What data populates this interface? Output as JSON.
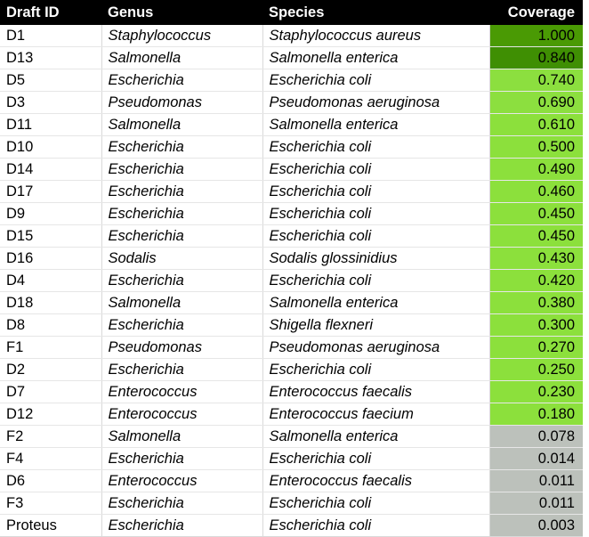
{
  "table": {
    "columns": [
      {
        "key": "draft_id",
        "label": "Draft ID",
        "align": "left"
      },
      {
        "key": "genus",
        "label": "Genus",
        "align": "left"
      },
      {
        "key": "species",
        "label": "Species",
        "align": "left"
      },
      {
        "key": "coverage",
        "label": "Coverage",
        "align": "right"
      }
    ],
    "colors": {
      "header_bg": "#000000",
      "header_text": "#ffffff",
      "row_bg": "#ffffff",
      "row_text": "#000000",
      "grid_line": "#d9d9d9",
      "heat_high": "#4a9a04",
      "heat_mid": "#8cdf3f",
      "heat_low": "#bcc1bb"
    },
    "rows": [
      {
        "draft_id": "D1",
        "genus": "Staphylococcus",
        "species": "Staphylococcus aureus",
        "coverage": "1.000",
        "coverage_value": 1.0,
        "cell_color": "#4a9a04"
      },
      {
        "draft_id": "D13",
        "genus": "Salmonella",
        "species": "Salmonella enterica",
        "coverage": "0.840",
        "coverage_value": 0.84,
        "cell_color": "#3f8f03"
      },
      {
        "draft_id": "D5",
        "genus": "Escherichia",
        "species": "Escherichia coli",
        "coverage": "0.740",
        "coverage_value": 0.74,
        "cell_color": "#8cdf3f"
      },
      {
        "draft_id": "D3",
        "genus": "Pseudomonas",
        "species": "Pseudomonas aeruginosa",
        "coverage": "0.690",
        "coverage_value": 0.69,
        "cell_color": "#8cdf3f"
      },
      {
        "draft_id": "D11",
        "genus": "Salmonella",
        "species": "Salmonella enterica",
        "coverage": "0.610",
        "coverage_value": 0.61,
        "cell_color": "#8ce03c"
      },
      {
        "draft_id": "D10",
        "genus": "Escherichia",
        "species": "Escherichia coli",
        "coverage": "0.500",
        "coverage_value": 0.5,
        "cell_color": "#8ce03c"
      },
      {
        "draft_id": "D14",
        "genus": "Escherichia",
        "species": "Escherichia coli",
        "coverage": "0.490",
        "coverage_value": 0.49,
        "cell_color": "#8ce03c"
      },
      {
        "draft_id": "D17",
        "genus": "Escherichia",
        "species": "Escherichia coli",
        "coverage": "0.460",
        "coverage_value": 0.46,
        "cell_color": "#8ce03c"
      },
      {
        "draft_id": "D9",
        "genus": "Escherichia",
        "species": "Escherichia coli",
        "coverage": "0.450",
        "coverage_value": 0.45,
        "cell_color": "#8ce03c"
      },
      {
        "draft_id": "D15",
        "genus": "Escherichia",
        "species": "Escherichia coli",
        "coverage": "0.450",
        "coverage_value": 0.45,
        "cell_color": "#8ce03c"
      },
      {
        "draft_id": "D16",
        "genus": "Sodalis",
        "species": "Sodalis glossinidius",
        "coverage": "0.430",
        "coverage_value": 0.43,
        "cell_color": "#8ce03c"
      },
      {
        "draft_id": "D4",
        "genus": "Escherichia",
        "species": "Escherichia coli",
        "coverage": "0.420",
        "coverage_value": 0.42,
        "cell_color": "#8ce03c"
      },
      {
        "draft_id": "D18",
        "genus": "Salmonella",
        "species": "Salmonella enterica",
        "coverage": "0.380",
        "coverage_value": 0.38,
        "cell_color": "#8ce03c"
      },
      {
        "draft_id": "D8",
        "genus": "Escherichia",
        "species": "Shigella flexneri",
        "coverage": "0.300",
        "coverage_value": 0.3,
        "cell_color": "#8ce03c"
      },
      {
        "draft_id": "F1",
        "genus": "Pseudomonas",
        "species": "Pseudomonas aeruginosa",
        "coverage": "0.270",
        "coverage_value": 0.27,
        "cell_color": "#8ce03c"
      },
      {
        "draft_id": "D2",
        "genus": "Escherichia",
        "species": "Escherichia coli",
        "coverage": "0.250",
        "coverage_value": 0.25,
        "cell_color": "#8ce03c"
      },
      {
        "draft_id": "D7",
        "genus": "Enterococcus",
        "species": "Enterococcus faecalis",
        "coverage": "0.230",
        "coverage_value": 0.23,
        "cell_color": "#8ce03c"
      },
      {
        "draft_id": "D12",
        "genus": "Enterococcus",
        "species": "Enterococcus faecium",
        "coverage": "0.180",
        "coverage_value": 0.18,
        "cell_color": "#8ce03c"
      },
      {
        "draft_id": "F2",
        "genus": "Salmonella",
        "species": "Salmonella enterica",
        "coverage": "0.078",
        "coverage_value": 0.078,
        "cell_color": "#bcc1bb"
      },
      {
        "draft_id": "F4",
        "genus": "Escherichia",
        "species": "Escherichia coli",
        "coverage": "0.014",
        "coverage_value": 0.014,
        "cell_color": "#bcc1bb"
      },
      {
        "draft_id": "D6",
        "genus": "Enterococcus",
        "species": "Enterococcus faecalis",
        "coverage": "0.011",
        "coverage_value": 0.011,
        "cell_color": "#bcc1bb"
      },
      {
        "draft_id": "F3",
        "genus": "Escherichia",
        "species": "Escherichia coli",
        "coverage": "0.011",
        "coverage_value": 0.011,
        "cell_color": "#bcc1bb"
      },
      {
        "draft_id": "Proteus",
        "genus": "Escherichia",
        "species": "Escherichia coli",
        "coverage": "0.003",
        "coverage_value": 0.003,
        "cell_color": "#bcc1bb"
      }
    ]
  },
  "chart_data": {
    "type": "table",
    "title": "",
    "columns": [
      "Draft ID",
      "Genus",
      "Species",
      "Coverage"
    ],
    "categories": [
      "D1",
      "D13",
      "D5",
      "D3",
      "D11",
      "D10",
      "D14",
      "D17",
      "D9",
      "D15",
      "D16",
      "D4",
      "D18",
      "D8",
      "F1",
      "D2",
      "D7",
      "D12",
      "F2",
      "F4",
      "D6",
      "F3",
      "Proteus"
    ],
    "values": [
      1.0,
      0.84,
      0.74,
      0.69,
      0.61,
      0.5,
      0.49,
      0.46,
      0.45,
      0.45,
      0.43,
      0.42,
      0.38,
      0.3,
      0.27,
      0.25,
      0.23,
      0.18,
      0.078,
      0.014,
      0.011,
      0.011,
      0.003
    ],
    "ylabel": "Coverage",
    "xlabel": "Draft ID",
    "ylim": [
      0,
      1
    ],
    "colorscale": {
      "high": "#4a9a04",
      "mid": "#8ce03c",
      "low": "#bcc1bb"
    },
    "legend": "none",
    "grid": true
  }
}
